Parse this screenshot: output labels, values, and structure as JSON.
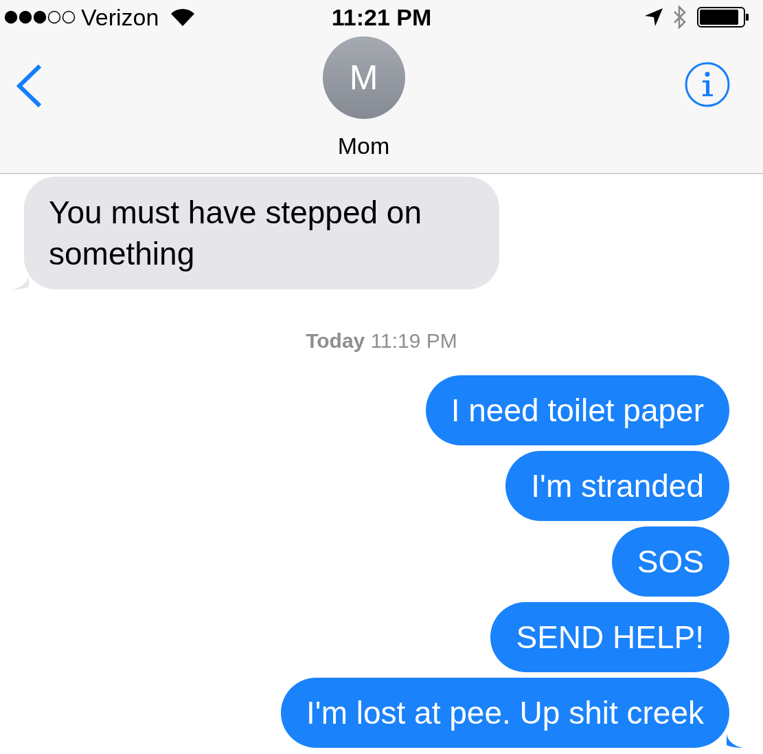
{
  "status_bar": {
    "carrier": "Verizon",
    "time": "11:21 PM"
  },
  "header": {
    "avatar_initial": "M",
    "contact_name": "Mom"
  },
  "messages": [
    {
      "kind": "received",
      "text": "You must have stepped on something",
      "tail": true
    },
    {
      "kind": "timestamp",
      "day": "Today",
      "time": "11:19 PM"
    },
    {
      "kind": "sent",
      "text": "I need toilet paper",
      "tail": false
    },
    {
      "kind": "sent",
      "text": "I'm stranded",
      "tail": false
    },
    {
      "kind": "sent",
      "text": "SOS",
      "tail": false
    },
    {
      "kind": "sent",
      "text": "SEND HELP!",
      "tail": false
    },
    {
      "kind": "sent",
      "text": "I'm lost at pee. Up shit creek",
      "tail": true
    }
  ]
}
